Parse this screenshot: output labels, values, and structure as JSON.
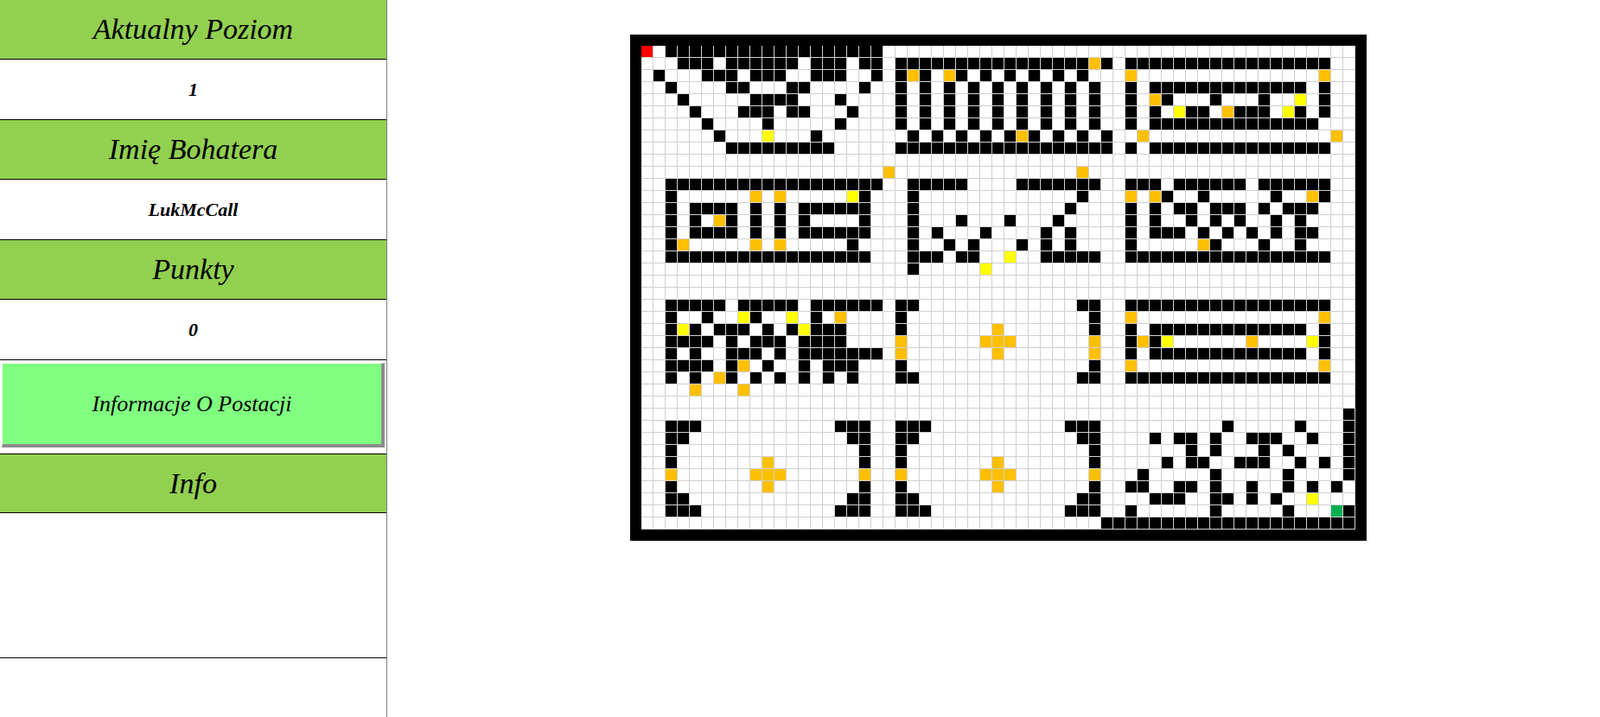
{
  "sidebar": {
    "fields": [
      {
        "label": "Aktualny Poziom",
        "value": "1"
      },
      {
        "label": "Imię Bohatera",
        "value": "LukMcCall"
      },
      {
        "label": "Punkty",
        "value": "0"
      }
    ],
    "button": "Informacje O Postacji",
    "info_label": "Info"
  },
  "maze": {
    "cell_kinds": [
      {
        "symbol": ".",
        "kind": "empty",
        "color": "#ffffff"
      },
      {
        "symbol": "#",
        "kind": "wall",
        "color": "#000000"
      },
      {
        "symbol": "o",
        "kind": "coin",
        "color": "#ffc000"
      },
      {
        "symbol": "y",
        "kind": "coin",
        "color": "#ffff00"
      },
      {
        "symbol": "S",
        "kind": "player",
        "color": "#ff0000"
      },
      {
        "symbol": "E",
        "kind": "exit",
        "color": "#00b050"
      }
    ],
    "rows": [
      "S.##################......................................",
      "...###.######.###.##.################o#.#################..",
      ".#...###.###..###..#.#o#.o#.#.#.#.#.#...o...............o..",
      "..#....##...##....#..#.#.#.#.#.#.#.#.#..#.#############.#..",
      "...#.....####...#....#.#.#.#.#.#.#.#.#..#.o#...#...#..y.#..",
      "....#...###.##...#...#.#.#.#.#.#.#.#.#..#.#.y##.o###.y#.#..",
      ".....#....#.....#....#.#.#.#.#.#.#.#.#..#.##############...",
      "......#...y...#.......#.#.#.#.#o#.#.#.#..o...............o..",
      ".......#########.....##################.#.###############..",
      "...........................................................",
      "....................o...............o......................",
      "..##################..#####....#######..###.######.######..",
      "..#......o.o.....y#...#.............#...o.o#..#.....#..o#..",
      "..#.####.#.#.######...#............#....#.#.##.###.#.###...",
      "..#.#.o#.#.#.#....#...#...#...#...#.....#.#..#.#.#..#.#....",
      "..#.####.#.#.######...#.#...#....#.#....#.###.#.#.#.#.##...",
      "..#o.....o.o.....#....#..#.#...#.#.#....#.....o#...#..#....",
      "..#################...###.##..y..#####..#################..",
      "......................#.....y..............................",
      "...........................................................",
      "...........................................................",
      "..#####.#####.######.##.............##..#################..",
      "..#..#..y#..y.#.o....#...............#..o...............o..",
      "..#y#.###.#.#y###....#.......o.......#..#.#############.#..",
      "..####.#.###.####....o......ooo......o..#o#y......o....y#..",
      "..#.#..###.#.#######.o.......o.......o..#.#############.#..",
      "..####.#o.#..#.###...#...............#..o...............o..",
      "..#.#.o#.#.#.#.#.#...##.............##..#################..",
      "....o...o..................................................",
      "...........................................................",
      "..........................................................#",
      "..###...........###..###...........###..........#.....#...#",
      "..##.............##..##.............##....#.##.#..###..#..#",
      "..#...............#..#...............#.......#.#...#.#....#",
      "..#.......o.......#..#.......o.......#.....#.##..###..#.#.#",
      "..o......ooo......o..o......ooo......o...#.....#.....#....#",
      "..#.......o.......#..#.......o.......#..##..##.#..#..#.#.#.#",
      "..##.............##..##.............##....###..##.#.#..y...#",
      "..###...........###..###...........###..#......#.....#...E#",
      "......................................#####################"
    ]
  }
}
